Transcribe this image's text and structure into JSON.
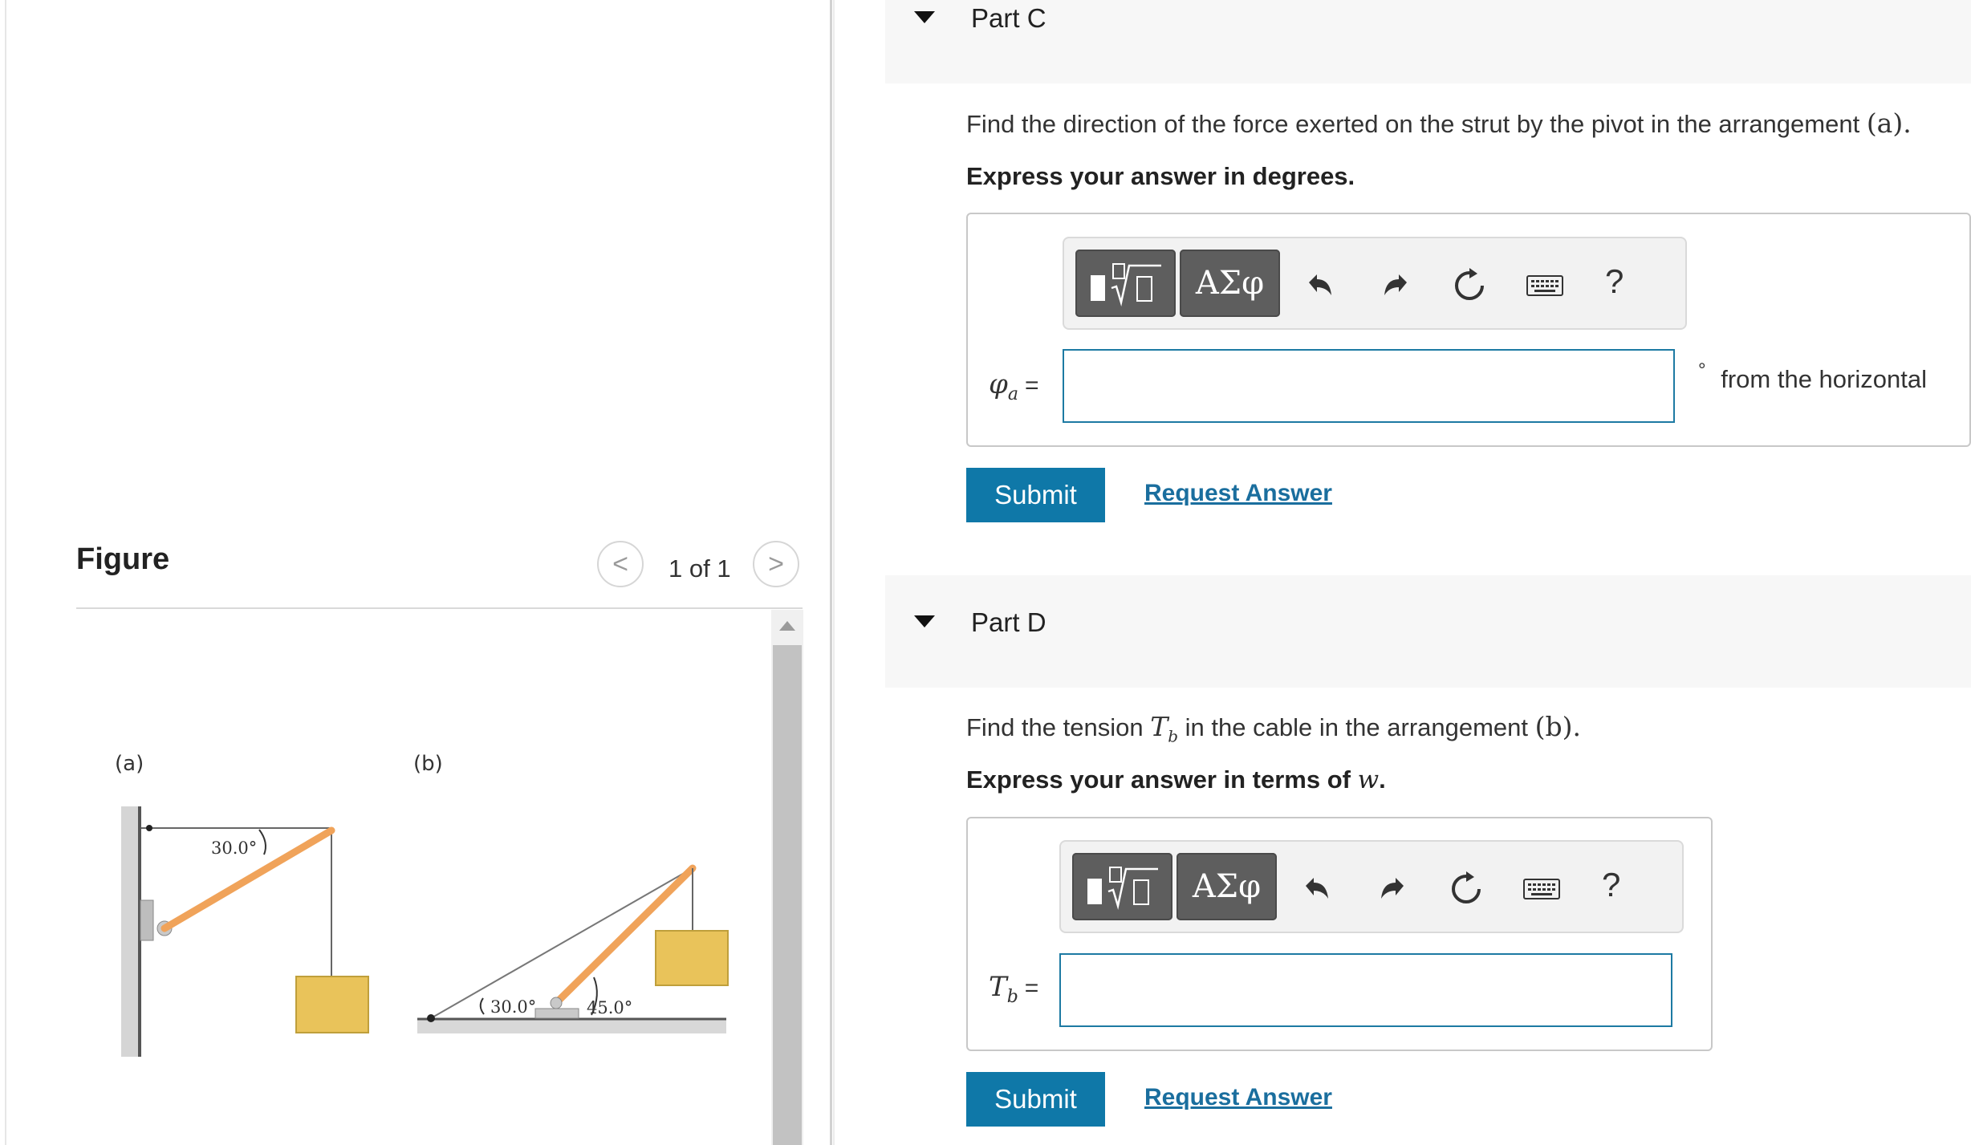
{
  "figure_panel": {
    "title": "Figure",
    "pager_text": "1 of 1",
    "prev_symbol": "<",
    "next_symbol": ">",
    "diagram": {
      "label_a": "(a)",
      "label_b": "(b)",
      "angle_a": "30.0°",
      "angle_b1": "30.0°",
      "angle_b2": "45.0°"
    }
  },
  "part_c": {
    "header": "Part C",
    "prompt_before": "Find the direction of the force exerted on the strut by the pivot in the arrangement ",
    "prompt_math": "(a).",
    "instruction": "Express your answer in degrees.",
    "toolbar": {
      "greek_label": "ΑΣφ",
      "help_label": "?"
    },
    "variable": "φ",
    "variable_sub": "a",
    "equals": "=",
    "input_value": "",
    "unit": "from the horizontal",
    "degree_symbol": "°",
    "submit_label": "Submit",
    "request_label": "Request Answer"
  },
  "part_d": {
    "header": "Part D",
    "prompt_before": "Find the tension ",
    "prompt_var": "T",
    "prompt_var_sub": "b",
    "prompt_middle": " in the cable in the arrangement ",
    "prompt_math": "(b).",
    "instruction_before": "Express your answer in terms of ",
    "instruction_var": "w",
    "instruction_after": ".",
    "toolbar": {
      "greek_label": "ΑΣφ",
      "help_label": "?"
    },
    "variable": "T",
    "variable_sub": "b",
    "equals": "=",
    "input_value": "",
    "submit_label": "Submit",
    "request_label": "Request Answer"
  },
  "colors": {
    "accent": "#0f78a8",
    "link": "#1a6e9e",
    "strut": "#f0a35a",
    "block": "#e9c35a",
    "toolbar_button": "#5e5e5e"
  }
}
